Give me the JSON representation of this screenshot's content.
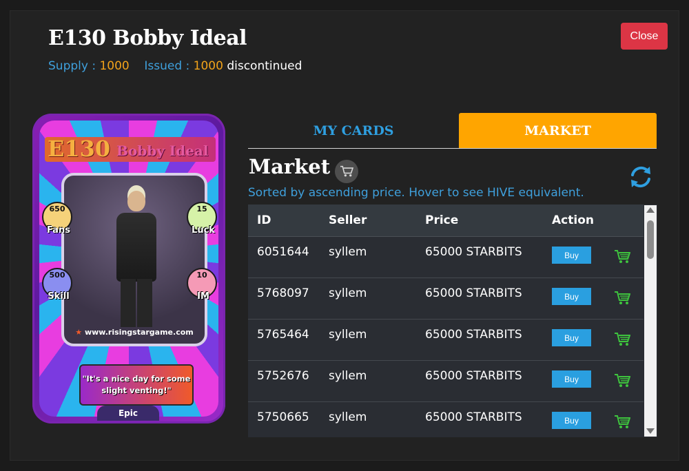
{
  "header": {
    "title": "E130 Bobby Ideal",
    "supply_label": "Supply :",
    "supply_value": "1000",
    "issued_label": "Issued :",
    "issued_value": "1000",
    "status": "discontinued",
    "close_label": "Close"
  },
  "card": {
    "code": "E130",
    "name": "Bobby Ideal",
    "stats": {
      "fans": {
        "value": "650",
        "label": "Fans"
      },
      "luck": {
        "value": "15",
        "label": "Luck"
      },
      "skill": {
        "value": "500",
        "label": "Skill"
      },
      "im": {
        "value": "10",
        "label": "IM"
      }
    },
    "website": "www.risingstargame.com",
    "quote": "\"It's a nice day for some slight venting!\"",
    "rarity": "Epic"
  },
  "tabs": [
    {
      "label": "MY CARDS",
      "active": false
    },
    {
      "label": "MARKET",
      "active": true
    }
  ],
  "market": {
    "title": "Market",
    "note": "Sorted by ascending price. Hover to see HIVE equivalent.",
    "columns": [
      "ID",
      "Seller",
      "Price",
      "Action"
    ],
    "buy_label": "Buy",
    "rows": [
      {
        "id": "6051644",
        "seller": "syllem",
        "price": "65000 STARBITS"
      },
      {
        "id": "5768097",
        "seller": "syllem",
        "price": "65000 STARBITS"
      },
      {
        "id": "5765464",
        "seller": "syllem",
        "price": "65000 STARBITS"
      },
      {
        "id": "5752676",
        "seller": "syllem",
        "price": "65000 STARBITS"
      },
      {
        "id": "5750665",
        "seller": "syllem",
        "price": "65000 STARBITS"
      }
    ]
  },
  "colors": {
    "accent_blue": "#3fa0dc",
    "accent_orange": "#ffa500",
    "number_orange": "#f2a31a",
    "close_red": "#dc3545",
    "cart_green": "#3ec43e"
  }
}
